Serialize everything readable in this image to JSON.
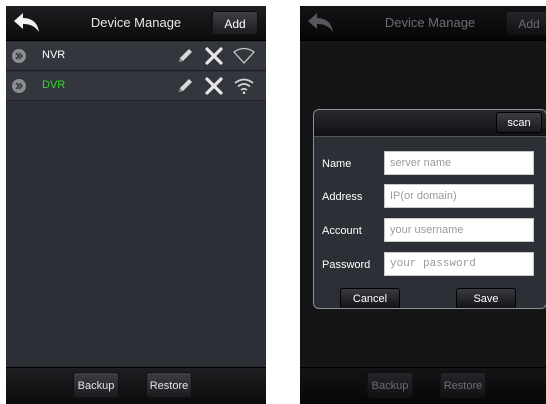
{
  "list_screen": {
    "title": "Device Manage",
    "add_label": "Add",
    "devices": [
      {
        "name": "NVR",
        "color": "#ffffff"
      },
      {
        "name": "DVR",
        "color": "#37d62a"
      }
    ],
    "backup_label": "Backup",
    "restore_label": "Restore"
  },
  "dialog_screen": {
    "title": "Device Manage",
    "add_label": "Add",
    "backup_label": "Backup",
    "restore_label": "Restore",
    "dialog": {
      "scan_label": "scan",
      "fields": [
        {
          "label": "Name",
          "placeholder": "server name"
        },
        {
          "label": "Address",
          "placeholder": "IP(or domain)"
        },
        {
          "label": "Account",
          "placeholder": "your username"
        },
        {
          "label": "Password",
          "placeholder": "your password"
        }
      ],
      "cancel_label": "Cancel",
      "save_label": "Save"
    }
  },
  "icons": [
    "back-arrow-icon",
    "chevron-right-icon",
    "pencil-icon",
    "delete-x-icon",
    "wifi-icon"
  ]
}
